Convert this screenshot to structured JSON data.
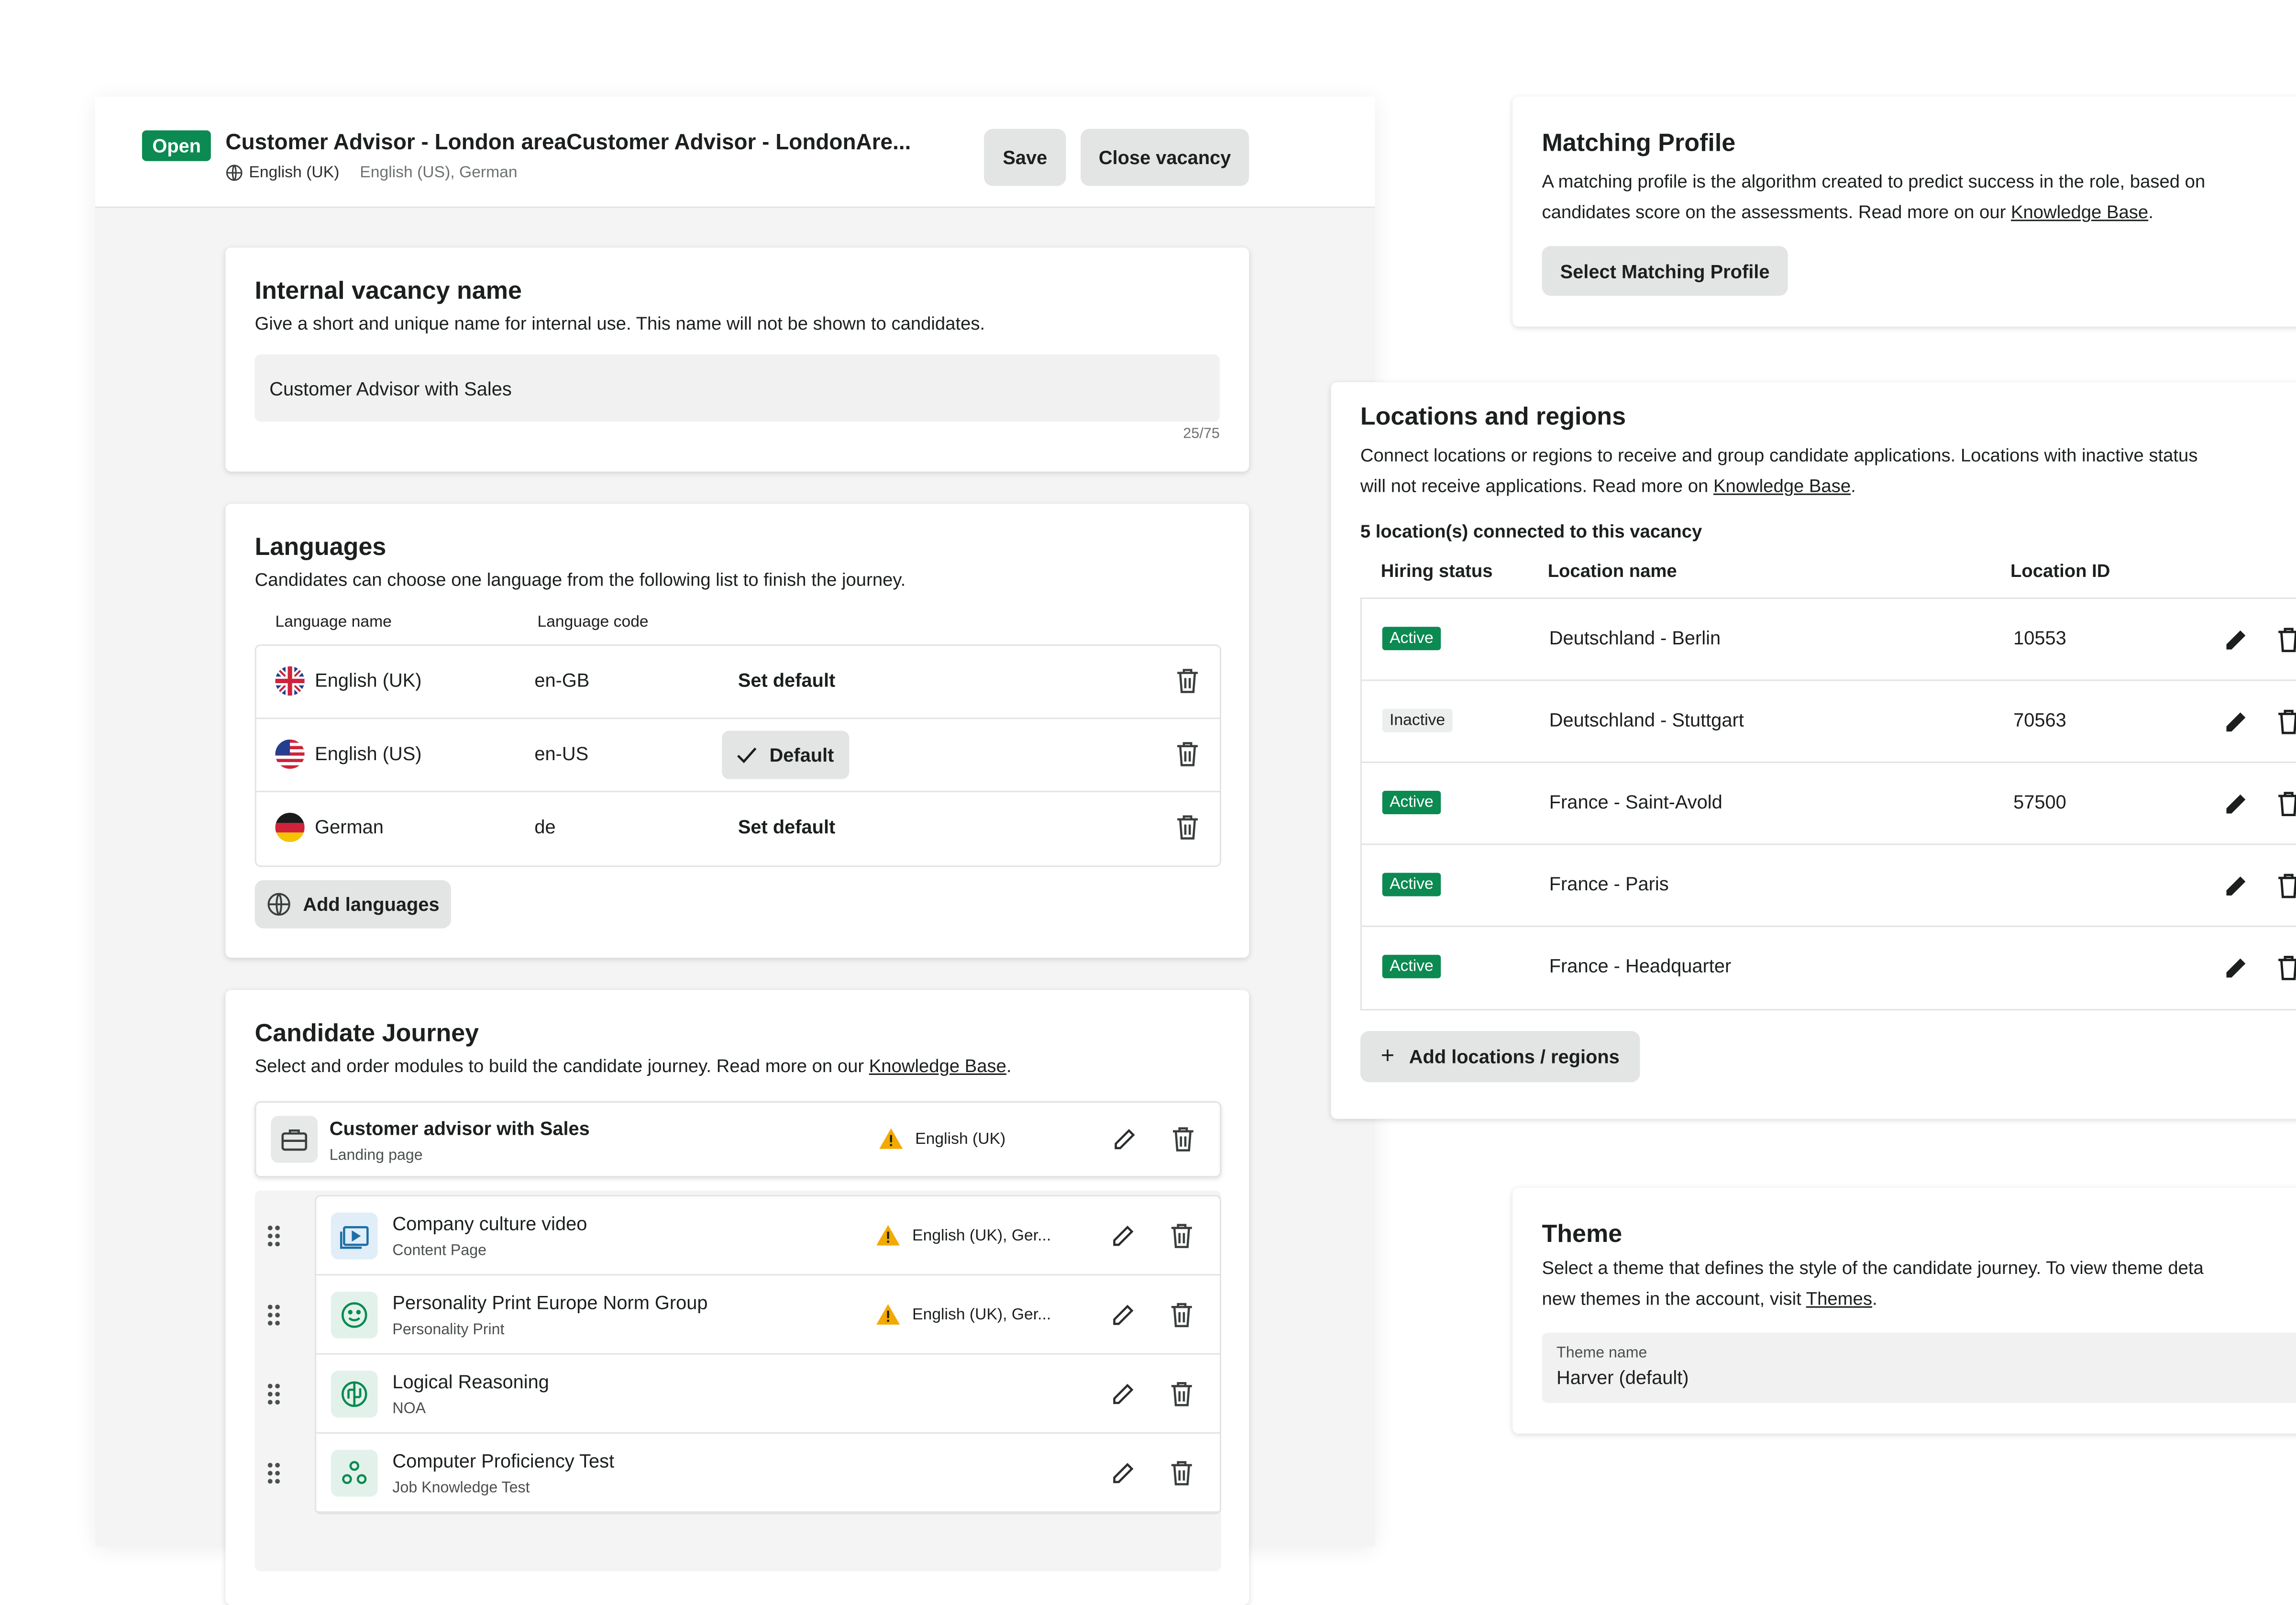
{
  "editor": {
    "status_badge": "Open",
    "vacancy_title": "Customer Advisor - London areaCustomer Advisor - LondonAre...",
    "current_language": "English (UK)",
    "other_languages": "English (US), German",
    "save_label": "Save",
    "close_label": "Close vacancy"
  },
  "internal_name": {
    "title": "Internal vacancy name",
    "description": "Give a short and unique name for internal use. This name will not be shown to candidates.",
    "value": "Customer Advisor with Sales",
    "counter": "25/75"
  },
  "languages": {
    "title": "Languages",
    "description": "Candidates can choose one language from the following list to finish the journey.",
    "col_name": "Language name",
    "col_code": "Language code",
    "rows": [
      {
        "name": "English (UK)",
        "code": "en-GB",
        "action": "Set default",
        "flag": "uk-flag"
      },
      {
        "name": "English (US)",
        "code": "en-US",
        "action": "Default",
        "flag": "us-flag"
      },
      {
        "name": "German",
        "code": "de",
        "action": "Set default",
        "flag": "germany-flag"
      }
    ],
    "add_label": "Add languages"
  },
  "journey": {
    "title": "Candidate Journey",
    "description_prefix": "Select and order modules to build the candidate journey. Read more on our ",
    "description_link": "Knowledge Base",
    "description_suffix": ".",
    "landing": {
      "title": "Customer advisor with Sales",
      "subtitle": "Landing page",
      "languages": "English (UK)"
    },
    "modules": [
      {
        "title": "Company culture video",
        "subtitle": "Content Page",
        "languages": "English (UK), Ger...",
        "warning": true,
        "icon": "video-icon"
      },
      {
        "title": "Personality Print Europe Norm Group",
        "subtitle": "Personality Print",
        "languages": "English (UK), Ger...",
        "warning": true,
        "icon": "smiley-icon"
      },
      {
        "title": "Logical Reasoning",
        "subtitle": "NOA",
        "languages": "",
        "warning": false,
        "icon": "brain-icon"
      },
      {
        "title": "Computer Proficiency Test",
        "subtitle": "Job Knowledge Test",
        "languages": "",
        "warning": false,
        "icon": "nodes-icon"
      }
    ]
  },
  "matching": {
    "title": "Matching Profile",
    "line1": "A matching profile is the algorithm created to predict success in the role, based on",
    "line2_prefix": "candidates score on the assessments. Read more on our ",
    "line2_link": "Knowledge Base",
    "line2_suffix": ".",
    "button": "Select Matching Profile"
  },
  "locations": {
    "title": "Locations and regions",
    "line1": "Connect locations or regions to receive and group candidate applications. Locations with inactive status",
    "line2_prefix": "will not receive applications. Read more on ",
    "line2_link": "Knowledge Base",
    "line2_suffix": ".",
    "count": "5 location(s) connected to this vacancy",
    "col_status": "Hiring status",
    "col_name": "Location name",
    "col_id": "Location ID",
    "rows": [
      {
        "status": "Active",
        "name": "Deutschland - Berlin",
        "id": "10553"
      },
      {
        "status": "Inactive",
        "name": "Deutschland - Stuttgart",
        "id": "70563"
      },
      {
        "status": "Active",
        "name": "France - Saint-Avold",
        "id": "57500"
      },
      {
        "status": "Active",
        "name": "France - Paris",
        "id": ""
      },
      {
        "status": "Active",
        "name": "France - Headquarter",
        "id": ""
      }
    ],
    "add_label": "Add locations / regions"
  },
  "theme": {
    "title": "Theme",
    "line1": "Select a theme that defines the style of the candidate journey. To view theme deta",
    "line2_prefix": "new themes in the account, visit ",
    "line2_link": "Themes",
    "line2_suffix": ".",
    "field_label": "Theme name",
    "field_value": "Harver (default)"
  },
  "colors": {
    "accent_green": "#0b8a52",
    "warning": "#f2a900",
    "surface": "#f3f4f3",
    "button": "#e3e5e4"
  }
}
